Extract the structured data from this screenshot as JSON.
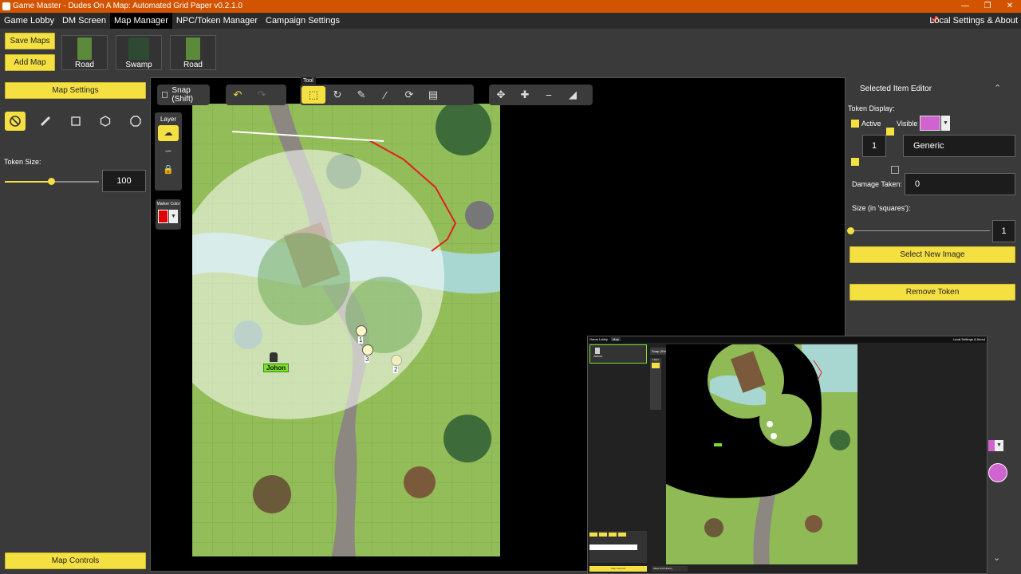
{
  "window": {
    "title": "Game Master - Dudes On A Map: Automated Grid Paper v0.2.1.0"
  },
  "menu": {
    "items": [
      {
        "label": "Game Lobby"
      },
      {
        "label": "DM Screen"
      },
      {
        "label": "Map Manager",
        "active": true
      },
      {
        "label": "NPC/Token Manager"
      },
      {
        "label": "Campaign Settings"
      }
    ],
    "local_settings": "Local Settings & About"
  },
  "maps": {
    "save_label": "Save Maps",
    "add_label": "Add Map",
    "thumbnails": [
      {
        "label": "Road",
        "color": "#5b8a3a"
      },
      {
        "label": "Swamp",
        "color": "#2f4a32"
      },
      {
        "label": "Road",
        "color": "#5b8a3a"
      }
    ]
  },
  "left": {
    "map_settings_label": "Map Settings",
    "token_size_label": "Token Size:",
    "token_size_value": "100",
    "token_size_fraction": 0.5,
    "map_controls_label": "Map Controls"
  },
  "toolbar": {
    "snap_label": "Snap (Shift)",
    "tool_tooltip": "Tool"
  },
  "layer": {
    "label": "Layer",
    "marker_color_label": "Marker Color",
    "marker_color": "#e00000"
  },
  "map": {
    "tokens": [
      {
        "number": "1"
      },
      {
        "number": "3"
      },
      {
        "number": "2"
      }
    ],
    "npc_label": "Johon"
  },
  "editor": {
    "title": "Selected Item Editor",
    "token_display_label": "Token Display:",
    "active_label": "Active",
    "visible_label": "Visible",
    "color": "#d063d0",
    "number_value": "1",
    "name_value": "Generic",
    "damage_label": "Damage Taken:",
    "damage_value": "0",
    "size_label": "Size (in 'squares'):",
    "size_value": "1",
    "select_image_label": "Select New Image",
    "remove_token_label": "Remove Token"
  },
  "preview": {
    "tab1": "Game Lobby",
    "tab2": "Map",
    "token_name": "Johon",
    "local_settings": "Local Settings & About",
    "snap_label": "Snap (Shift)",
    "layer_label": "Layer",
    "map_controls": "Map Controls",
    "bottom_tab": "Allow Grid History"
  },
  "colors": {
    "accent": "#f5e042",
    "titlebar": "#d35400",
    "grass": "#8fba55"
  }
}
